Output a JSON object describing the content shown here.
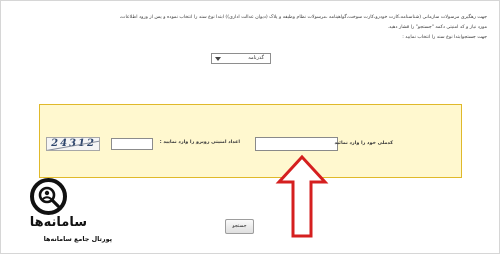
{
  "instructions": {
    "line_1": "جهت رهگیری مرسولات سازمانی (شناسنامه،کارت خودرو،کارت سوخت،گواهینامه ،مرسولات نظام وظیفه  و پلاک (دیوان عدالت اداری)) ابتدا  نوع سند را انتخاب نموده و پس از ورود اطلاعات،",
    "line_2": "مورد نیاز و کد امنیتی دکمه \"جستجو\" را فشار دهید.",
    "line_3": "جهت جستجوابتدا نوع سند را انتخاب نمایید :"
  },
  "document_type": {
    "selected": "گذرنامه"
  },
  "search_form": {
    "id_label": "کدملی خود را وارد نمائید",
    "captcha_label": "اعداد امنیتی روبرو را وارد نمایید :",
    "captcha_text": "24312",
    "search_button": "جستجو"
  },
  "watermark": {
    "title": "سامانه‌ها",
    "subtitle": "پورتال جامع سامانه‌ها"
  },
  "colors": {
    "panel_background": "#fff8cf",
    "panel_border": "#e0b92a",
    "arrow_red": "#d51f1f"
  },
  "icons": {
    "dropdown": "chevron-down-icon",
    "arrow": "arrow-up-icon",
    "brand": "search-person-icon"
  }
}
